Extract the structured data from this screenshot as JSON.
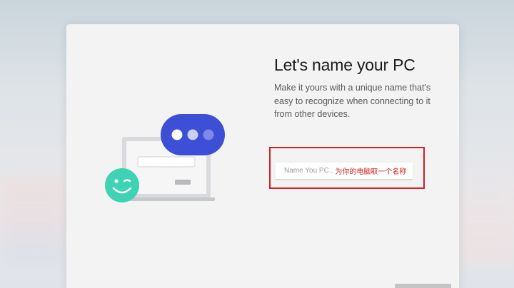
{
  "window": {
    "title": "Let's name your PC",
    "subtitle": "Make it yours with a unique name that's easy to recognize when connecting to it from other devices."
  },
  "name_field": {
    "value": "",
    "placeholder": "Name You PC..",
    "annotation": "为你的电脑取一个名称"
  },
  "next_button": {
    "label": ""
  },
  "colors": {
    "annotation_red": "#d42020",
    "chat_bubble_blue": "#3d4fd6",
    "smiley_teal": "#3fd2b5"
  },
  "icons": [
    "laptop-icon",
    "chat-bubble-icon",
    "smiley-icon"
  ]
}
